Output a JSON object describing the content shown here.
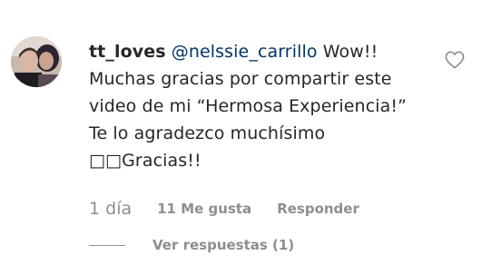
{
  "comment": {
    "username": "tt_loves",
    "mention": "@nelssie_carrillo",
    "text": "Wow!! Muchas gracias por compartir este video de mi “Hermosa Experiencia!” Te lo agradezco muchísimo □□Gracias!!",
    "time": "1 día",
    "likes": "11 Me gusta",
    "reply_label": "Responder",
    "view_replies": "Ver respuestas (1)",
    "like_icon": "heart-outline-icon",
    "avatar_icon": "user-avatar-photo"
  },
  "colors": {
    "text": "#262626",
    "mention": "#003569",
    "muted": "#8e8e8e"
  }
}
